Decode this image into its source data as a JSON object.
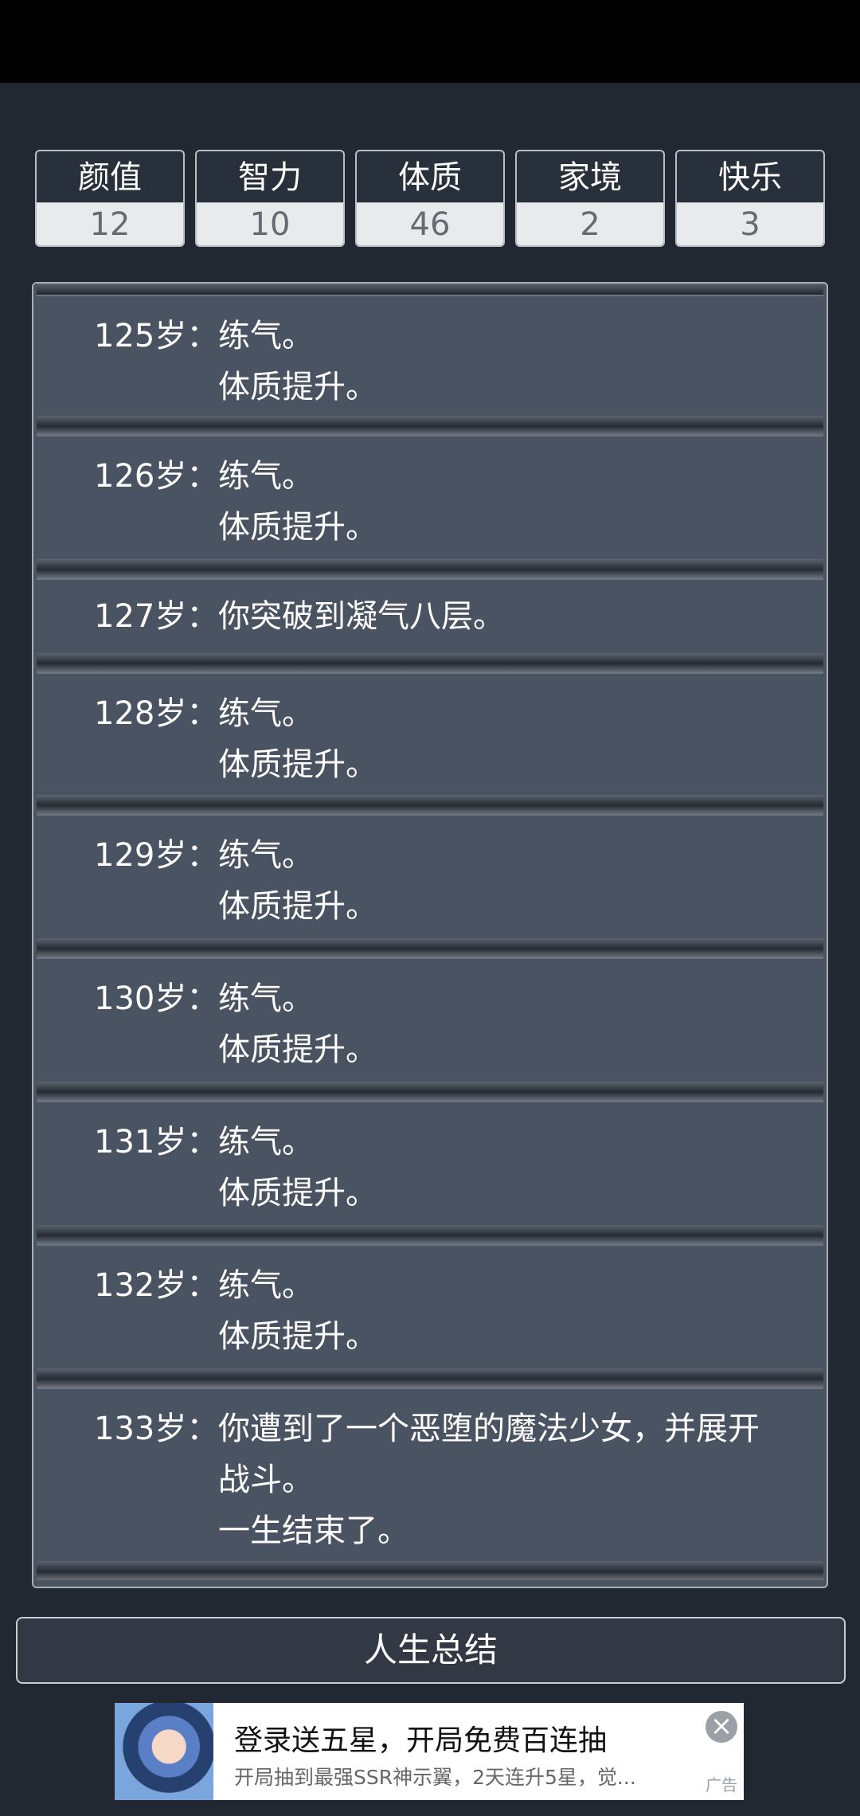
{
  "stats": [
    {
      "label": "颜值",
      "value": "12"
    },
    {
      "label": "智力",
      "value": "10"
    },
    {
      "label": "体质",
      "value": "46"
    },
    {
      "label": "家境",
      "value": "2"
    },
    {
      "label": "快乐",
      "value": "3"
    }
  ],
  "log": [
    {
      "age": "125岁：",
      "lines": [
        "练气。",
        "体质提升。"
      ]
    },
    {
      "age": "126岁：",
      "lines": [
        "练气。",
        "体质提升。"
      ]
    },
    {
      "age": "127岁：",
      "lines": [
        "你突破到凝气八层。"
      ]
    },
    {
      "age": "128岁：",
      "lines": [
        "练气。",
        "体质提升。"
      ]
    },
    {
      "age": "129岁：",
      "lines": [
        "练气。",
        "体质提升。"
      ]
    },
    {
      "age": "130岁：",
      "lines": [
        "练气。",
        "体质提升。"
      ]
    },
    {
      "age": "131岁：",
      "lines": [
        "练气。",
        "体质提升。"
      ]
    },
    {
      "age": "132岁：",
      "lines": [
        "练气。",
        "体质提升。"
      ]
    },
    {
      "age": "133岁：",
      "lines": [
        "你遭到了一个恶堕的魔法少女，并展开",
        "战斗。",
        "一生结束了。"
      ]
    }
  ],
  "summary_button": "人生总结",
  "ad": {
    "title": "登录送五星，开局免费百连抽",
    "subtitle": "开局抽到最强SSR神示翼，2天连升5星，觉...",
    "close_icon": "×",
    "mark": "广告"
  }
}
